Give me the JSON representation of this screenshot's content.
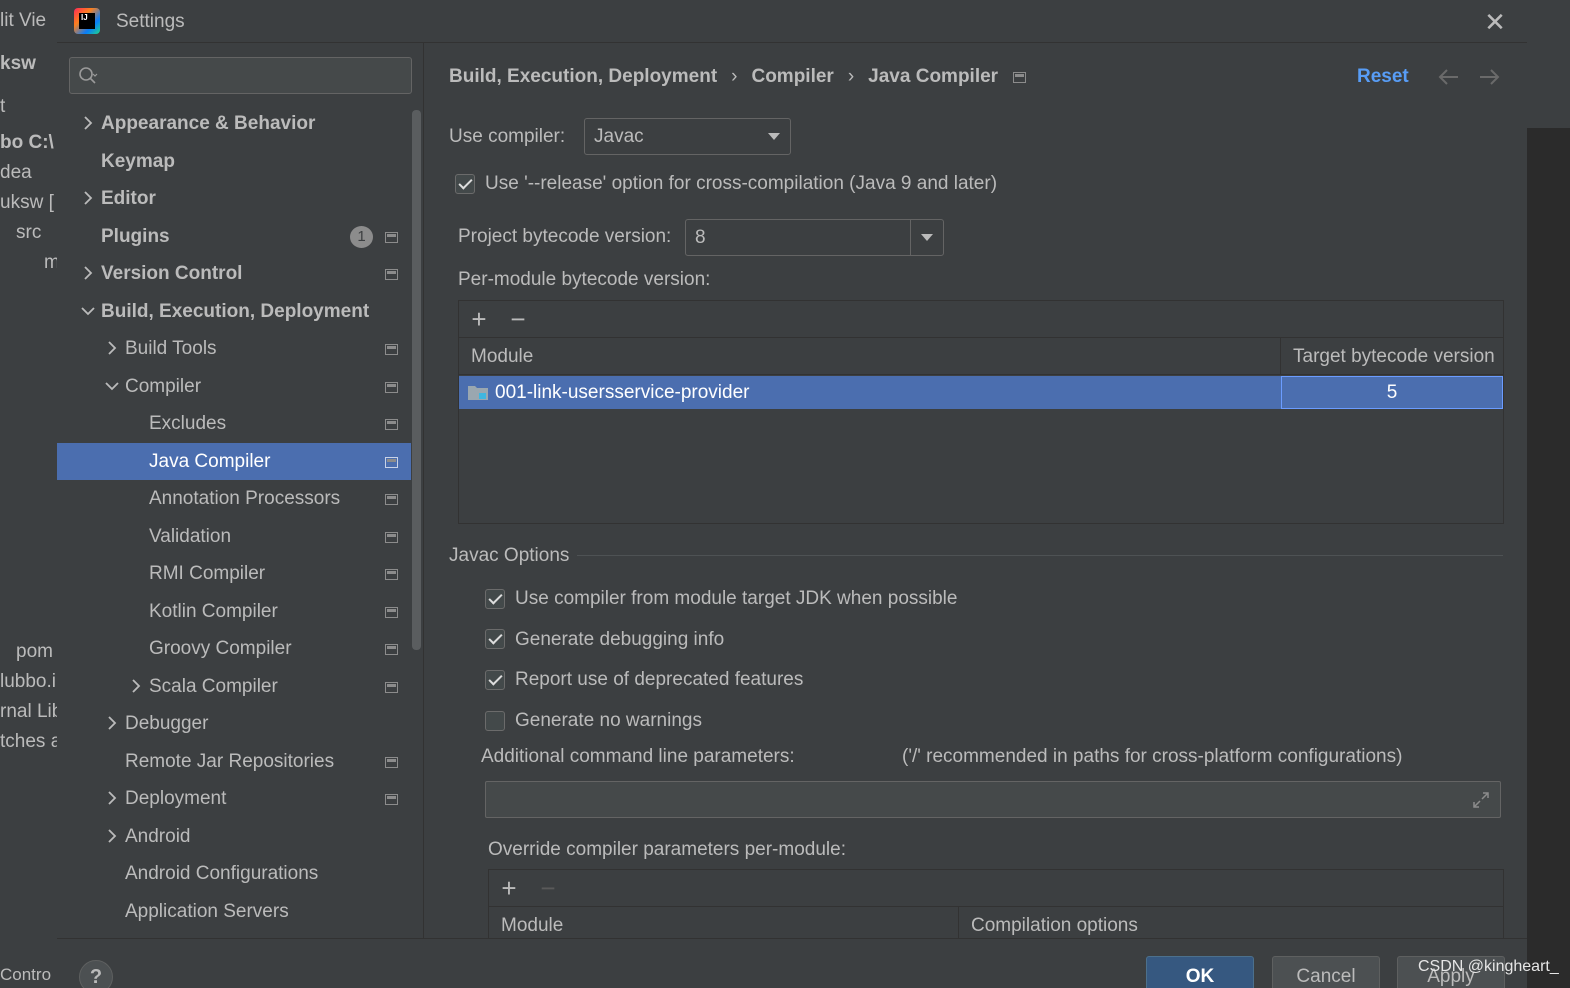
{
  "background_ide": {
    "left_fragments": [
      "lit  Vie",
      "ksw",
      "t",
      "bo C:\\",
      "dea",
      "uksw [",
      "src",
      "m",
      "pom",
      "lubbo.i",
      "rnal Lib",
      "tches a",
      "Contro"
    ]
  },
  "dialog": {
    "title": "Settings",
    "close_glyph": "✕"
  },
  "sidebar": {
    "search_placeholder": "",
    "items": [
      {
        "label": "Appearance & Behavior",
        "level": 0,
        "bold": true,
        "expandable": true,
        "expanded": false
      },
      {
        "label": "Keymap",
        "level": 0,
        "bold": true,
        "expandable": false
      },
      {
        "label": "Editor",
        "level": 0,
        "bold": true,
        "expandable": true,
        "expanded": false
      },
      {
        "label": "Plugins",
        "level": 0,
        "bold": true,
        "expandable": false,
        "badge": "1",
        "project_icon": true
      },
      {
        "label": "Version Control",
        "level": 0,
        "bold": true,
        "expandable": true,
        "expanded": false,
        "project_icon": true
      },
      {
        "label": "Build, Execution, Deployment",
        "level": 0,
        "bold": true,
        "expandable": true,
        "expanded": true
      },
      {
        "label": "Build Tools",
        "level": 1,
        "expandable": true,
        "expanded": false,
        "project_icon": true
      },
      {
        "label": "Compiler",
        "level": 1,
        "expandable": true,
        "expanded": true,
        "project_icon": true
      },
      {
        "label": "Excludes",
        "level": 2,
        "expandable": false,
        "project_icon": true
      },
      {
        "label": "Java Compiler",
        "level": 2,
        "expandable": false,
        "project_icon": true,
        "selected": true
      },
      {
        "label": "Annotation Processors",
        "level": 2,
        "expandable": false,
        "project_icon": true
      },
      {
        "label": "Validation",
        "level": 2,
        "expandable": false,
        "project_icon": true
      },
      {
        "label": "RMI Compiler",
        "level": 2,
        "expandable": false,
        "project_icon": true
      },
      {
        "label": "Kotlin Compiler",
        "level": 2,
        "expandable": false,
        "project_icon": true
      },
      {
        "label": "Groovy Compiler",
        "level": 2,
        "expandable": false,
        "project_icon": true
      },
      {
        "label": "Scala Compiler",
        "level": 2,
        "expandable": true,
        "expanded": false,
        "project_icon": true
      },
      {
        "label": "Debugger",
        "level": 1,
        "expandable": true,
        "expanded": false
      },
      {
        "label": "Remote Jar Repositories",
        "level": 1,
        "expandable": false,
        "project_icon": true
      },
      {
        "label": "Deployment",
        "level": 1,
        "expandable": true,
        "expanded": false,
        "project_icon": true
      },
      {
        "label": "Android",
        "level": 1,
        "expandable": true,
        "expanded": false
      },
      {
        "label": "Android Configurations",
        "level": 1,
        "expandable": false
      },
      {
        "label": "Application Servers",
        "level": 1,
        "expandable": false
      }
    ]
  },
  "breadcrumb": {
    "items": [
      "Build, Execution, Deployment",
      "Compiler",
      "Java Compiler"
    ],
    "separator": "›"
  },
  "header": {
    "reset_label": "Reset"
  },
  "compiler": {
    "use_compiler_label": "Use compiler:",
    "use_compiler_value": "Javac",
    "release_option_label": "Use '--release' option for cross-compilation (Java 9 and later)",
    "release_option_checked": true,
    "project_bytecode_label": "Project bytecode version:",
    "project_bytecode_value": "8",
    "per_module_label": "Per-module bytecode version:"
  },
  "per_module_table": {
    "add_label": "+",
    "remove_label": "−",
    "columns": [
      "Module",
      "Target bytecode version"
    ],
    "rows": [
      {
        "module": "001-link-usersservice-provider",
        "target": "5",
        "selected": true
      }
    ]
  },
  "javac_options": {
    "title": "Javac Options",
    "checkboxes": [
      {
        "label": "Use compiler from module target JDK when possible",
        "checked": true
      },
      {
        "label": "Generate debugging info",
        "checked": true
      },
      {
        "label": "Report use of deprecated features",
        "checked": true
      },
      {
        "label": "Generate no warnings",
        "checked": false
      }
    ],
    "additional_params_label": "Additional command line parameters:",
    "additional_params_hint": "('/' recommended in paths for cross-platform configurations)",
    "additional_params_value": "",
    "override_label": "Override compiler parameters per-module:"
  },
  "override_table": {
    "add_label": "+",
    "remove_label": "−",
    "columns": [
      "Module",
      "Compilation options"
    ]
  },
  "footer": {
    "help_label": "?",
    "ok_label": "OK",
    "cancel_label": "Cancel",
    "apply_label": "Apply"
  },
  "watermark": "CSDN @kingheart_",
  "colors": {
    "selection": "#4b6eaf",
    "link": "#589df6",
    "primary_button": "#365880",
    "panel_bg": "#3c3f41"
  }
}
